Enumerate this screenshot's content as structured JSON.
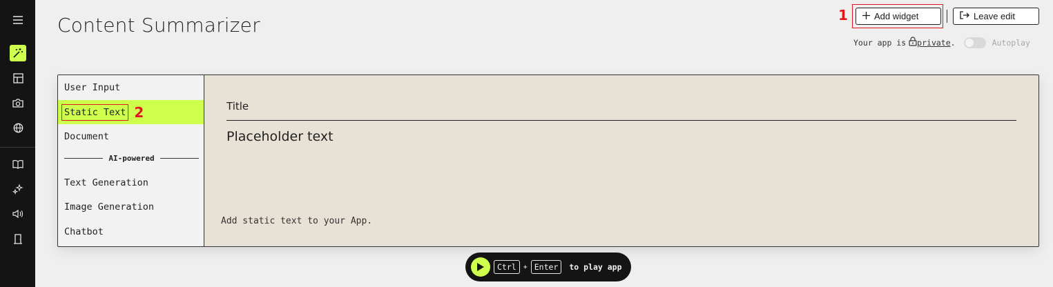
{
  "rail": {
    "icons": [
      "menu-icon",
      "magic-wand-icon",
      "layout-icon",
      "camera-icon",
      "globe-icon",
      "book-icon",
      "sparkles-icon",
      "speaker-icon",
      "door-icon"
    ]
  },
  "header": {
    "title": "Content Summarizer",
    "add_widget_label": "Add widget",
    "leave_edit_label": "Leave edit",
    "marker_1": "1",
    "marker_2": "2"
  },
  "privacy": {
    "prefix": "Your app is",
    "link": "private",
    "suffix": ".",
    "autoplay_label": "Autoplay",
    "autoplay_on": false
  },
  "widgets": {
    "items": [
      {
        "label": "User Input",
        "selected": false
      },
      {
        "label": "Static Text",
        "selected": true
      },
      {
        "label": "Document",
        "selected": false
      },
      {
        "label": "Text Generation",
        "selected": false
      },
      {
        "label": "Image Generation",
        "selected": false
      },
      {
        "label": "Chatbot",
        "selected": false
      }
    ],
    "section_label": "AI-powered"
  },
  "preview": {
    "title": "Title",
    "placeholder": "Placeholder text",
    "description": "Add static text to your App."
  },
  "play": {
    "key1": "Ctrl",
    "plus": "+",
    "key2": "Enter",
    "hint": "to play app"
  },
  "colors": {
    "accent": "#cfff4d",
    "annotation_red": "#e0181e",
    "rail_bg": "#141414",
    "preview_bg": "#e8e1d6"
  }
}
